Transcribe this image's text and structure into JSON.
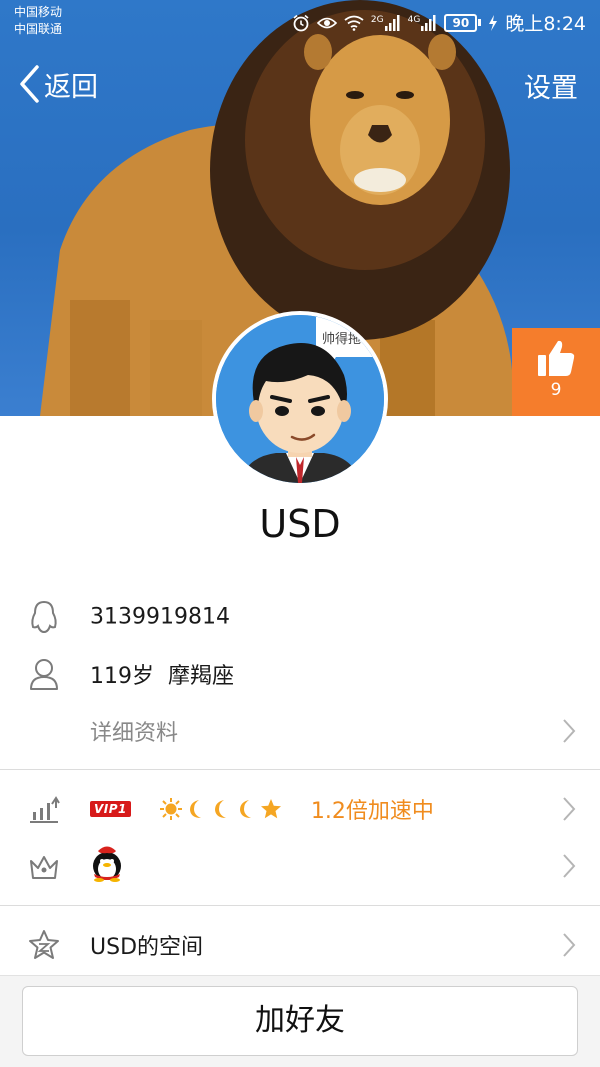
{
  "status_bar": {
    "carrier_1": "中国移动",
    "carrier_2": "中国联通",
    "net_1": "2G",
    "net_2": "4G",
    "battery": "90",
    "time": "晚上8:24"
  },
  "nav": {
    "back_label": "返回",
    "settings_label": "设置"
  },
  "cover": {
    "like_count": "9"
  },
  "avatar": {
    "bubble_text": "帅得拖"
  },
  "profile": {
    "name": "USD",
    "qq_number": "3139919814",
    "age": "119岁",
    "zodiac": "摩羯座",
    "details_label": "详细资料"
  },
  "level": {
    "vip_label": "VIP1",
    "speed_text": "1.2倍加速中"
  },
  "space": {
    "label": "USD的空间"
  },
  "actions": {
    "add_friend_label": "加好友"
  },
  "colors": {
    "accent_orange": "#f57d2c",
    "vip_red": "#d71a1a",
    "speed_orange": "#f08c1e",
    "sky_blue": "#2f78c9"
  }
}
